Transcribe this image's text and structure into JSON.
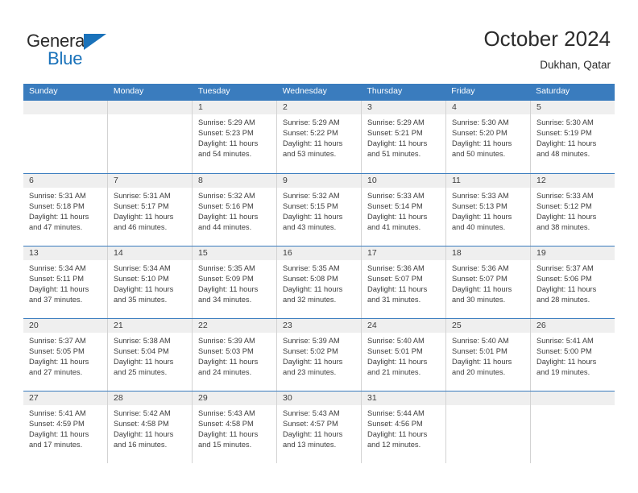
{
  "brand": {
    "name_part1": "General",
    "name_part2": "Blue",
    "accent_color": "#1a72ba"
  },
  "header": {
    "month_title": "October 2024",
    "location": "Dukhan, Qatar"
  },
  "calendar": {
    "header_color": "#3a7cbe",
    "daynum_band_color": "#efefef",
    "weekday_headers": [
      "Sunday",
      "Monday",
      "Tuesday",
      "Wednesday",
      "Thursday",
      "Friday",
      "Saturday"
    ],
    "weeks": [
      [
        {
          "day": "",
          "empty": true,
          "sunrise": "",
          "sunset": "",
          "daylight_line1": "",
          "daylight_line2": ""
        },
        {
          "day": "",
          "empty": true,
          "sunrise": "",
          "sunset": "",
          "daylight_line1": "",
          "daylight_line2": ""
        },
        {
          "day": "1",
          "empty": false,
          "sunrise": "Sunrise: 5:29 AM",
          "sunset": "Sunset: 5:23 PM",
          "daylight_line1": "Daylight: 11 hours",
          "daylight_line2": "and 54 minutes."
        },
        {
          "day": "2",
          "empty": false,
          "sunrise": "Sunrise: 5:29 AM",
          "sunset": "Sunset: 5:22 PM",
          "daylight_line1": "Daylight: 11 hours",
          "daylight_line2": "and 53 minutes."
        },
        {
          "day": "3",
          "empty": false,
          "sunrise": "Sunrise: 5:29 AM",
          "sunset": "Sunset: 5:21 PM",
          "daylight_line1": "Daylight: 11 hours",
          "daylight_line2": "and 51 minutes."
        },
        {
          "day": "4",
          "empty": false,
          "sunrise": "Sunrise: 5:30 AM",
          "sunset": "Sunset: 5:20 PM",
          "daylight_line1": "Daylight: 11 hours",
          "daylight_line2": "and 50 minutes."
        },
        {
          "day": "5",
          "empty": false,
          "sunrise": "Sunrise: 5:30 AM",
          "sunset": "Sunset: 5:19 PM",
          "daylight_line1": "Daylight: 11 hours",
          "daylight_line2": "and 48 minutes."
        }
      ],
      [
        {
          "day": "6",
          "empty": false,
          "sunrise": "Sunrise: 5:31 AM",
          "sunset": "Sunset: 5:18 PM",
          "daylight_line1": "Daylight: 11 hours",
          "daylight_line2": "and 47 minutes."
        },
        {
          "day": "7",
          "empty": false,
          "sunrise": "Sunrise: 5:31 AM",
          "sunset": "Sunset: 5:17 PM",
          "daylight_line1": "Daylight: 11 hours",
          "daylight_line2": "and 46 minutes."
        },
        {
          "day": "8",
          "empty": false,
          "sunrise": "Sunrise: 5:32 AM",
          "sunset": "Sunset: 5:16 PM",
          "daylight_line1": "Daylight: 11 hours",
          "daylight_line2": "and 44 minutes."
        },
        {
          "day": "9",
          "empty": false,
          "sunrise": "Sunrise: 5:32 AM",
          "sunset": "Sunset: 5:15 PM",
          "daylight_line1": "Daylight: 11 hours",
          "daylight_line2": "and 43 minutes."
        },
        {
          "day": "10",
          "empty": false,
          "sunrise": "Sunrise: 5:33 AM",
          "sunset": "Sunset: 5:14 PM",
          "daylight_line1": "Daylight: 11 hours",
          "daylight_line2": "and 41 minutes."
        },
        {
          "day": "11",
          "empty": false,
          "sunrise": "Sunrise: 5:33 AM",
          "sunset": "Sunset: 5:13 PM",
          "daylight_line1": "Daylight: 11 hours",
          "daylight_line2": "and 40 minutes."
        },
        {
          "day": "12",
          "empty": false,
          "sunrise": "Sunrise: 5:33 AM",
          "sunset": "Sunset: 5:12 PM",
          "daylight_line1": "Daylight: 11 hours",
          "daylight_line2": "and 38 minutes."
        }
      ],
      [
        {
          "day": "13",
          "empty": false,
          "sunrise": "Sunrise: 5:34 AM",
          "sunset": "Sunset: 5:11 PM",
          "daylight_line1": "Daylight: 11 hours",
          "daylight_line2": "and 37 minutes."
        },
        {
          "day": "14",
          "empty": false,
          "sunrise": "Sunrise: 5:34 AM",
          "sunset": "Sunset: 5:10 PM",
          "daylight_line1": "Daylight: 11 hours",
          "daylight_line2": "and 35 minutes."
        },
        {
          "day": "15",
          "empty": false,
          "sunrise": "Sunrise: 5:35 AM",
          "sunset": "Sunset: 5:09 PM",
          "daylight_line1": "Daylight: 11 hours",
          "daylight_line2": "and 34 minutes."
        },
        {
          "day": "16",
          "empty": false,
          "sunrise": "Sunrise: 5:35 AM",
          "sunset": "Sunset: 5:08 PM",
          "daylight_line1": "Daylight: 11 hours",
          "daylight_line2": "and 32 minutes."
        },
        {
          "day": "17",
          "empty": false,
          "sunrise": "Sunrise: 5:36 AM",
          "sunset": "Sunset: 5:07 PM",
          "daylight_line1": "Daylight: 11 hours",
          "daylight_line2": "and 31 minutes."
        },
        {
          "day": "18",
          "empty": false,
          "sunrise": "Sunrise: 5:36 AM",
          "sunset": "Sunset: 5:07 PM",
          "daylight_line1": "Daylight: 11 hours",
          "daylight_line2": "and 30 minutes."
        },
        {
          "day": "19",
          "empty": false,
          "sunrise": "Sunrise: 5:37 AM",
          "sunset": "Sunset: 5:06 PM",
          "daylight_line1": "Daylight: 11 hours",
          "daylight_line2": "and 28 minutes."
        }
      ],
      [
        {
          "day": "20",
          "empty": false,
          "sunrise": "Sunrise: 5:37 AM",
          "sunset": "Sunset: 5:05 PM",
          "daylight_line1": "Daylight: 11 hours",
          "daylight_line2": "and 27 minutes."
        },
        {
          "day": "21",
          "empty": false,
          "sunrise": "Sunrise: 5:38 AM",
          "sunset": "Sunset: 5:04 PM",
          "daylight_line1": "Daylight: 11 hours",
          "daylight_line2": "and 25 minutes."
        },
        {
          "day": "22",
          "empty": false,
          "sunrise": "Sunrise: 5:39 AM",
          "sunset": "Sunset: 5:03 PM",
          "daylight_line1": "Daylight: 11 hours",
          "daylight_line2": "and 24 minutes."
        },
        {
          "day": "23",
          "empty": false,
          "sunrise": "Sunrise: 5:39 AM",
          "sunset": "Sunset: 5:02 PM",
          "daylight_line1": "Daylight: 11 hours",
          "daylight_line2": "and 23 minutes."
        },
        {
          "day": "24",
          "empty": false,
          "sunrise": "Sunrise: 5:40 AM",
          "sunset": "Sunset: 5:01 PM",
          "daylight_line1": "Daylight: 11 hours",
          "daylight_line2": "and 21 minutes."
        },
        {
          "day": "25",
          "empty": false,
          "sunrise": "Sunrise: 5:40 AM",
          "sunset": "Sunset: 5:01 PM",
          "daylight_line1": "Daylight: 11 hours",
          "daylight_line2": "and 20 minutes."
        },
        {
          "day": "26",
          "empty": false,
          "sunrise": "Sunrise: 5:41 AM",
          "sunset": "Sunset: 5:00 PM",
          "daylight_line1": "Daylight: 11 hours",
          "daylight_line2": "and 19 minutes."
        }
      ],
      [
        {
          "day": "27",
          "empty": false,
          "sunrise": "Sunrise: 5:41 AM",
          "sunset": "Sunset: 4:59 PM",
          "daylight_line1": "Daylight: 11 hours",
          "daylight_line2": "and 17 minutes."
        },
        {
          "day": "28",
          "empty": false,
          "sunrise": "Sunrise: 5:42 AM",
          "sunset": "Sunset: 4:58 PM",
          "daylight_line1": "Daylight: 11 hours",
          "daylight_line2": "and 16 minutes."
        },
        {
          "day": "29",
          "empty": false,
          "sunrise": "Sunrise: 5:43 AM",
          "sunset": "Sunset: 4:58 PM",
          "daylight_line1": "Daylight: 11 hours",
          "daylight_line2": "and 15 minutes."
        },
        {
          "day": "30",
          "empty": false,
          "sunrise": "Sunrise: 5:43 AM",
          "sunset": "Sunset: 4:57 PM",
          "daylight_line1": "Daylight: 11 hours",
          "daylight_line2": "and 13 minutes."
        },
        {
          "day": "31",
          "empty": false,
          "sunrise": "Sunrise: 5:44 AM",
          "sunset": "Sunset: 4:56 PM",
          "daylight_line1": "Daylight: 11 hours",
          "daylight_line2": "and 12 minutes."
        },
        {
          "day": "",
          "empty": true,
          "sunrise": "",
          "sunset": "",
          "daylight_line1": "",
          "daylight_line2": ""
        },
        {
          "day": "",
          "empty": true,
          "sunrise": "",
          "sunset": "",
          "daylight_line1": "",
          "daylight_line2": ""
        }
      ]
    ]
  }
}
